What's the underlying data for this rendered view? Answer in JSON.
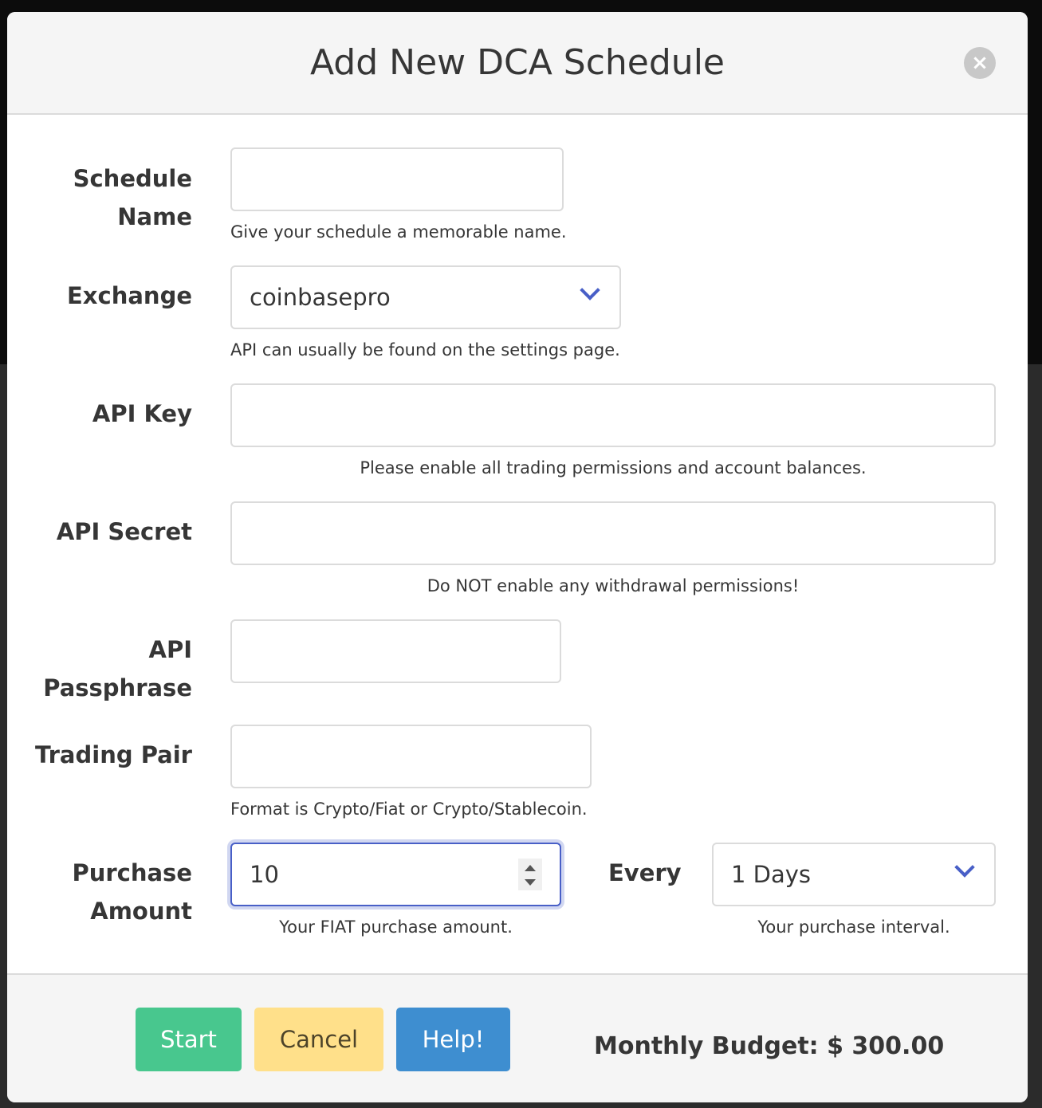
{
  "modal": {
    "title": "Add New DCA Schedule",
    "close_icon": "close-icon"
  },
  "form": {
    "schedule_name": {
      "label": "Schedule Name",
      "value": "",
      "help": "Give your schedule a memorable name."
    },
    "exchange": {
      "label": "Exchange",
      "value": "coinbasepro",
      "help": "API can usually be found on the settings page."
    },
    "api_key": {
      "label": "API Key",
      "value": "",
      "help": "Please enable all trading permissions and account balances."
    },
    "api_secret": {
      "label": "API Secret",
      "value": "",
      "help": "Do NOT enable any withdrawal permissions!"
    },
    "api_passphrase": {
      "label": "API Passphrase",
      "value": ""
    },
    "trading_pair": {
      "label": "Trading Pair",
      "value": "",
      "help": "Format is Crypto/Fiat or Crypto/Stablecoin."
    },
    "purchase_amount": {
      "label": "Purchase Amount",
      "value": "10",
      "help": "Your FIAT purchase amount."
    },
    "every": {
      "label": "Every",
      "value": "1 Days",
      "help": "Your purchase interval."
    }
  },
  "footer": {
    "start": "Start",
    "cancel": "Cancel",
    "help": "Help!",
    "budget": "Monthly Budget: $ 300.00"
  },
  "colors": {
    "start": "#48c78e",
    "cancel": "#ffe08a",
    "help": "#3e8ed0",
    "focus": "#485fc7"
  }
}
